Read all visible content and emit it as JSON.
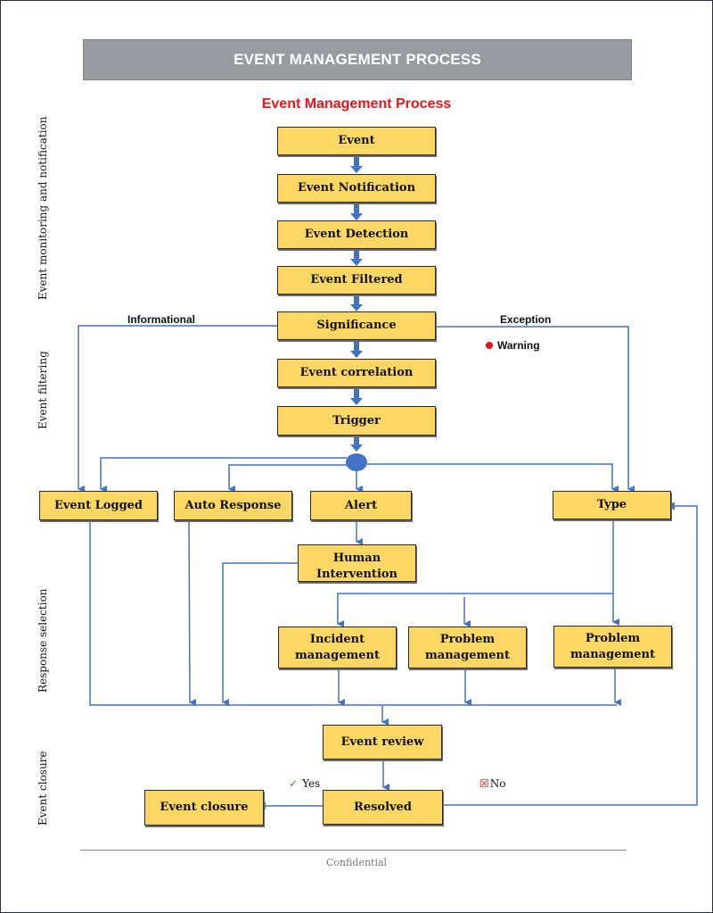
{
  "header": {
    "banner_title": "EVENT MANAGEMENT PROCESS",
    "diagram_title": "Event Management Process"
  },
  "lanes": [
    {
      "id": "monitoring",
      "label": "Event monitoring and notification"
    },
    {
      "id": "filtering",
      "label": "Event filtering"
    },
    {
      "id": "response",
      "label": "Response selection"
    },
    {
      "id": "closure",
      "label": "Event closure"
    }
  ],
  "nodes": {
    "event": "Event",
    "event_notification": "Event Notification",
    "event_detection": "Event Detection",
    "event_filtered": "Event Filtered",
    "significance": "Significance",
    "event_correlation": "Event correlation",
    "trigger": "Trigger",
    "event_logged": "Event Logged",
    "auto_response": "Auto Response",
    "alert": "Alert",
    "type": "Type",
    "human_intervention": "Human Intervention",
    "incident_management": "Incident management",
    "problem_management_1": "Problem management",
    "problem_management_2": "Problem management",
    "event_review": "Event review",
    "resolved": "Resolved",
    "event_closure": "Event closure"
  },
  "branch_labels": {
    "informational": "Informational",
    "exception": "Exception",
    "warning": "Warning",
    "yes": "Yes",
    "no": "No"
  },
  "edges": [
    {
      "from": "event",
      "to": "event_notification"
    },
    {
      "from": "event_notification",
      "to": "event_detection"
    },
    {
      "from": "event_detection",
      "to": "event_filtered"
    },
    {
      "from": "event_filtered",
      "to": "significance"
    },
    {
      "from": "significance",
      "to": "event_correlation",
      "label": "Warning"
    },
    {
      "from": "event_correlation",
      "to": "trigger"
    },
    {
      "from": "significance",
      "to": "event_logged",
      "label": "Informational"
    },
    {
      "from": "significance",
      "to": "type",
      "label": "Exception"
    },
    {
      "from": "trigger",
      "to": "event_logged"
    },
    {
      "from": "trigger",
      "to": "auto_response"
    },
    {
      "from": "trigger",
      "to": "alert"
    },
    {
      "from": "trigger",
      "to": "type"
    },
    {
      "from": "alert",
      "to": "human_intervention"
    },
    {
      "from": "type",
      "to": "incident_management"
    },
    {
      "from": "type",
      "to": "problem_management_1"
    },
    {
      "from": "type",
      "to": "problem_management_2"
    },
    {
      "from": "event_logged",
      "to": "event_review"
    },
    {
      "from": "auto_response",
      "to": "event_review"
    },
    {
      "from": "human_intervention",
      "to": "event_review"
    },
    {
      "from": "incident_management",
      "to": "event_review"
    },
    {
      "from": "problem_management_1",
      "to": "event_review"
    },
    {
      "from": "problem_management_2",
      "to": "event_review"
    },
    {
      "from": "event_review",
      "to": "resolved"
    },
    {
      "from": "resolved",
      "to": "event_closure",
      "label": "Yes"
    },
    {
      "from": "resolved",
      "to": "type",
      "label": "No"
    }
  ],
  "colors": {
    "box_fill": "#fdd764",
    "connector": "#4472c4",
    "banner": "#979ca3",
    "title_red": "#e8141b"
  },
  "footer": {
    "text": "Confidential"
  }
}
